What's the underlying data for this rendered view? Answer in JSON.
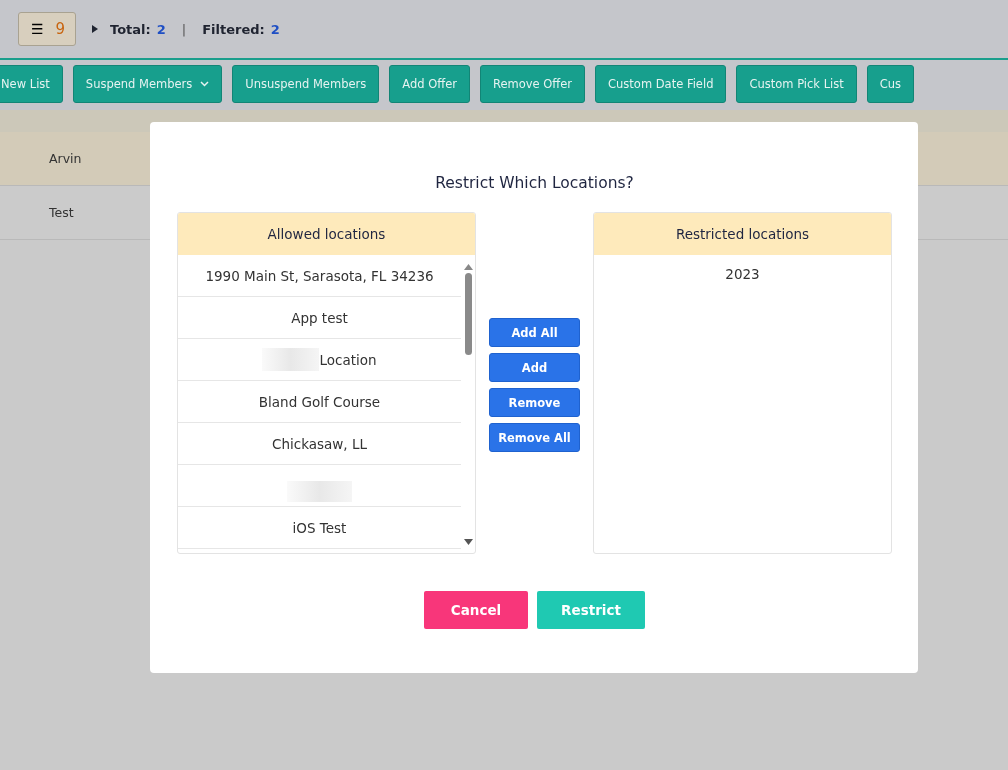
{
  "topbar": {
    "menu_icon": "☰",
    "menu_count": "9",
    "total_label": "Total:",
    "total": "2",
    "separator": "|",
    "filtered_label": "Filtered:",
    "filtered": "2"
  },
  "toolbar": [
    {
      "label": "New List",
      "dropdown": false
    },
    {
      "label": "Suspend Members",
      "dropdown": true
    },
    {
      "label": "Unsuspend Members",
      "dropdown": false
    },
    {
      "label": "Add Offer",
      "dropdown": false
    },
    {
      "label": "Remove Offer",
      "dropdown": false
    },
    {
      "label": "Custom Date Field",
      "dropdown": false
    },
    {
      "label": "Custom Pick List",
      "dropdown": false
    },
    {
      "label": "Cus",
      "dropdown": false
    }
  ],
  "rows": [
    {
      "name": "Arvin",
      "selected": true
    },
    {
      "name": "Test",
      "selected": false
    }
  ],
  "dialog": {
    "title": "Restrict Which Locations?",
    "allowed": {
      "heading": "Allowed locations",
      "items": [
        {
          "kind": "text",
          "label": "1990 Main St, Sarasota, FL 34236"
        },
        {
          "kind": "text",
          "label": "App test"
        },
        {
          "kind": "masked-prefix",
          "label": "Location"
        },
        {
          "kind": "text",
          "label": "Bland Golf Course"
        },
        {
          "kind": "text",
          "label": "Chickasaw, LL"
        },
        {
          "kind": "masked"
        },
        {
          "kind": "text",
          "label": "iOS Test"
        }
      ]
    },
    "actions": [
      "Add All",
      "Add",
      "Remove",
      "Remove All"
    ],
    "restricted": {
      "heading": "Restricted locations",
      "items": [
        {
          "kind": "text",
          "label": "2023"
        }
      ]
    },
    "buttons": [
      {
        "label": "Cancel",
        "kind": "cancel"
      },
      {
        "label": "Restrict",
        "kind": "confirm"
      }
    ]
  }
}
